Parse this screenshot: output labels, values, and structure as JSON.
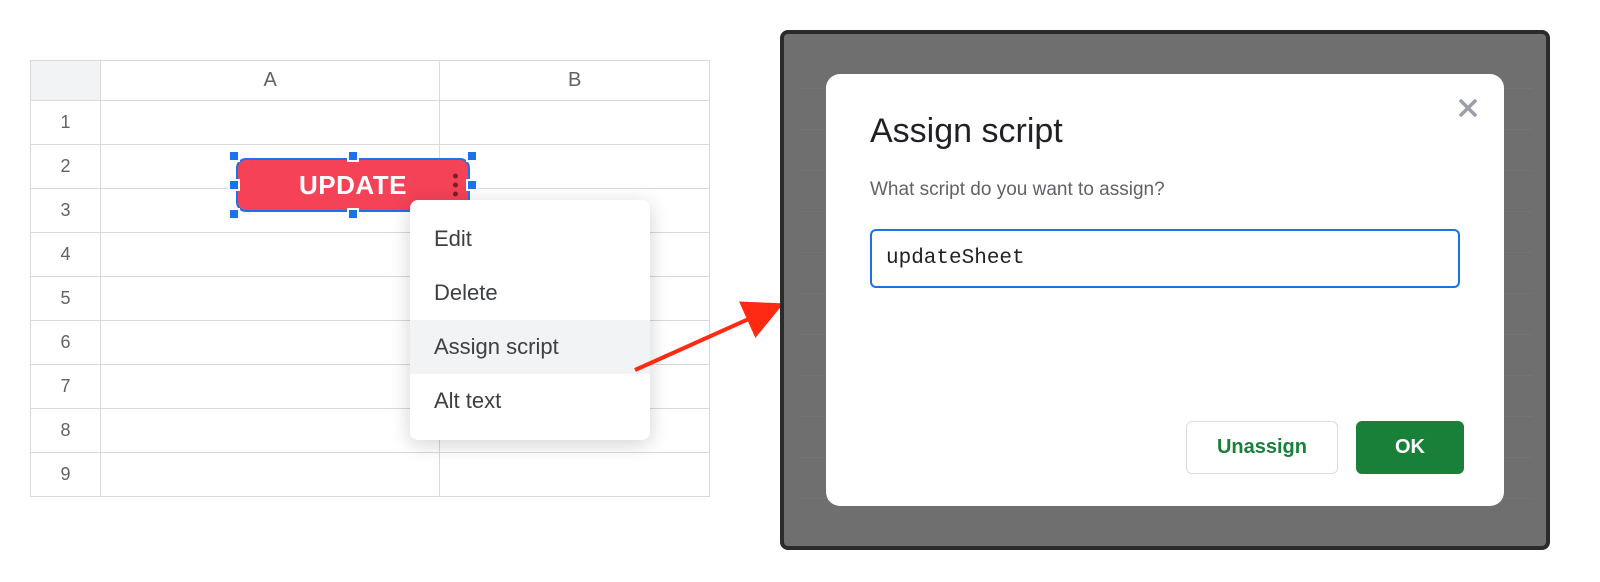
{
  "sheet": {
    "columns": [
      "A",
      "B"
    ],
    "rows": [
      "1",
      "2",
      "3",
      "4",
      "5",
      "6",
      "7",
      "8",
      "9"
    ]
  },
  "drawing": {
    "label": "UPDATE"
  },
  "context_menu": {
    "items": [
      {
        "label": "Edit",
        "hover": false
      },
      {
        "label": "Delete",
        "hover": false
      },
      {
        "label": "Assign script",
        "hover": true
      },
      {
        "label": "Alt text",
        "hover": false
      }
    ]
  },
  "dialog": {
    "title": "Assign script",
    "prompt": "What script do you want to assign?",
    "input_value": "updateSheet",
    "button_unassign": "Unassign",
    "button_ok": "OK"
  }
}
